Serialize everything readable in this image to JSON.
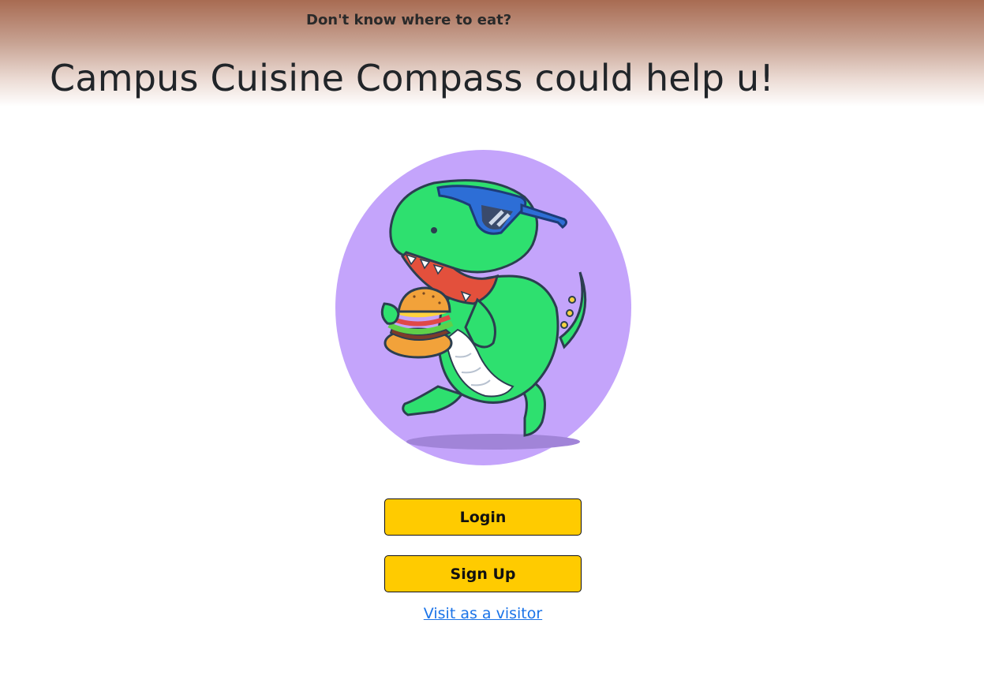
{
  "hero": {
    "tagline": "Don't know where to eat?",
    "title": "Campus Cuisine Compass could help u!"
  },
  "mascot": {
    "icon": "dinosaur-eating-burger-illustration",
    "background_color": "#c4a4fb",
    "body_color": "#2ee06f"
  },
  "actions": {
    "login_label": "Login",
    "signup_label": "Sign Up",
    "visitor_label": "Visit as a visitor",
    "button_color": "#ffcb00",
    "link_color": "#1a73e8"
  }
}
